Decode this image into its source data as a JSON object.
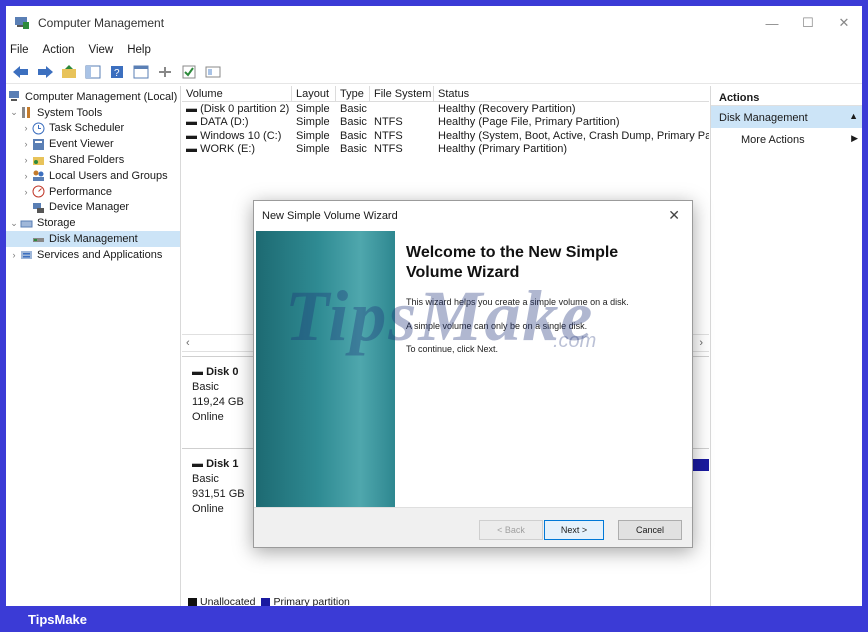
{
  "window": {
    "title": "Computer Management"
  },
  "menu": [
    "File",
    "Action",
    "View",
    "Help"
  ],
  "tree": [
    {
      "label": "Computer Management (Local)",
      "indent": 0,
      "arrow": ""
    },
    {
      "label": "System Tools",
      "indent": 1,
      "arrow": "v"
    },
    {
      "label": "Task Scheduler",
      "indent": 2,
      "arrow": ">"
    },
    {
      "label": "Event Viewer",
      "indent": 2,
      "arrow": ">"
    },
    {
      "label": "Shared Folders",
      "indent": 2,
      "arrow": ">"
    },
    {
      "label": "Local Users and Groups",
      "indent": 2,
      "arrow": ">"
    },
    {
      "label": "Performance",
      "indent": 2,
      "arrow": ">"
    },
    {
      "label": "Device Manager",
      "indent": 2,
      "arrow": ""
    },
    {
      "label": "Storage",
      "indent": 1,
      "arrow": "v"
    },
    {
      "label": "Disk Management",
      "indent": 2,
      "arrow": ""
    },
    {
      "label": "Services and Applications",
      "indent": 1,
      "arrow": ">"
    }
  ],
  "volumes": {
    "headers": [
      "Volume",
      "Layout",
      "Type",
      "File System",
      "Status"
    ],
    "rows": [
      [
        "(Disk 0 partition 2)",
        "Simple",
        "Basic",
        "",
        "Healthy (Recovery Partition)"
      ],
      [
        "DATA (D:)",
        "Simple",
        "Basic",
        "NTFS",
        "Healthy (Page File, Primary Partition)"
      ],
      [
        "Windows 10 (C:)",
        "Simple",
        "Basic",
        "NTFS",
        "Healthy (System, Boot, Active, Crash Dump, Primary Partit"
      ],
      [
        "WORK (E:)",
        "Simple",
        "Basic",
        "NTFS",
        "Healthy (Primary Partition)"
      ]
    ]
  },
  "disks": [
    {
      "name": "Disk 0",
      "type": "Basic",
      "size": "119,24 GB",
      "state": "Online"
    },
    {
      "name": "Disk 1",
      "type": "Basic",
      "size": "931,51 GB",
      "state": "Online"
    }
  ],
  "legend": [
    "Unallocated",
    "Primary partition"
  ],
  "actions": {
    "header": "Actions",
    "items": [
      "Disk Management",
      "More Actions"
    ]
  },
  "wizard": {
    "title": "New Simple Volume Wizard",
    "heading": "Welcome to the New Simple Volume Wizard",
    "p1": "This wizard helps you create a simple volume on a disk.",
    "p2": "A simple volume can only be on a single disk.",
    "p3": "To continue, click Next.",
    "back": "< Back",
    "next": "Next >",
    "cancel": "Cancel"
  },
  "watermark": {
    "main": "TipsMake",
    "suffix": ".com"
  },
  "footer": "TipsMake",
  "colors": {
    "frame": "#3b3bd6",
    "selection": "#cce4f7",
    "primary_partition": "#1a1aa0",
    "wizard_side": "#2f8b93"
  }
}
